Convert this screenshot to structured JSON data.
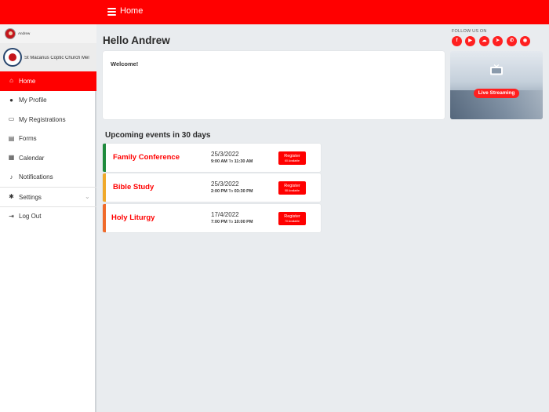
{
  "header": {
    "title": "Home"
  },
  "sidebar": {
    "user_name": "Andrew",
    "church_name": "St Macarius Coptic Church Mel",
    "items": [
      {
        "label": "Home",
        "icon": "home-icon",
        "glyph": "⌂"
      },
      {
        "label": "My Profile",
        "icon": "user-icon",
        "glyph": "●"
      },
      {
        "label": "My Registrations",
        "icon": "id-card-icon",
        "glyph": "▭"
      },
      {
        "label": "Forms",
        "icon": "form-icon",
        "glyph": "▤"
      },
      {
        "label": "Calendar",
        "icon": "calendar-icon",
        "glyph": "▦"
      },
      {
        "label": "Notifications",
        "icon": "bell-icon",
        "glyph": "♪"
      },
      {
        "label": "Settings",
        "icon": "gear-icon",
        "glyph": "✱"
      },
      {
        "label": "Log Out",
        "icon": "logout-icon",
        "glyph": "⇥"
      }
    ]
  },
  "main": {
    "greeting": "Hello  Andrew",
    "welcome_text": "Welcome!",
    "follow_label": "FOLLOW US ON",
    "social": [
      {
        "icon": "facebook-icon",
        "glyph": "f"
      },
      {
        "icon": "youtube-icon",
        "glyph": "▶"
      },
      {
        "icon": "soundcloud-icon",
        "glyph": "☁"
      },
      {
        "icon": "telegram-icon",
        "glyph": "➤"
      },
      {
        "icon": "whatsapp-icon",
        "glyph": "✆"
      },
      {
        "icon": "website-icon",
        "glyph": "◉"
      }
    ],
    "live_streaming_label": "Live Streaming",
    "events_heading": "Upcoming events in 30 days",
    "events": [
      {
        "name": "Family Conference",
        "date": "25/3/2022",
        "start": "9:00 AM",
        "to": "To",
        "end": "11:30 AM",
        "register_label": "Register",
        "available": "60 Available",
        "color": "#1e8a3c"
      },
      {
        "name": "Bible Study",
        "date": "25/3/2022",
        "start": "2:00 PM",
        "to": "To",
        "end": "03:30 PM",
        "register_label": "Register",
        "available": "58 Available",
        "color": "#f0a92a"
      },
      {
        "name": "Holy Liturgy",
        "date": "17/4/2022",
        "start": "7:00 PM",
        "to": "To",
        "end": "10:00 PM",
        "register_label": "Register",
        "available": "70 Available",
        "color": "#f06a2a"
      }
    ]
  }
}
